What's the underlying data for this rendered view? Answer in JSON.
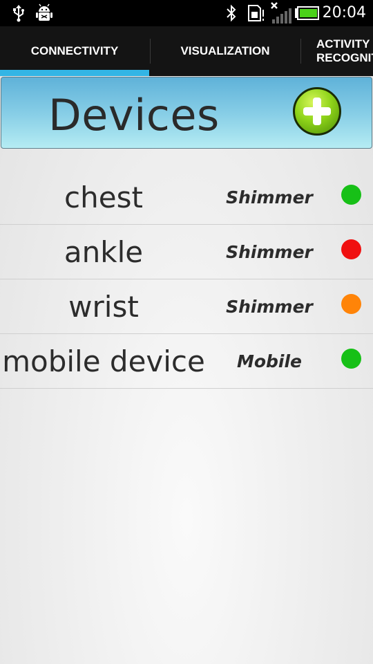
{
  "status_bar": {
    "time": "20:04",
    "icons": [
      "usb-icon",
      "android-debug-icon",
      "bluetooth-icon",
      "sd-card-icon",
      "no-signal-icon",
      "battery-icon"
    ]
  },
  "tabs": [
    {
      "label": "CONNECTIVITY",
      "selected": true
    },
    {
      "label": "VISUALIZATION",
      "selected": false
    },
    {
      "label": "ACTIVITY RECOGNIT",
      "selected": false
    }
  ],
  "header": {
    "title": "Devices",
    "add_icon": "add-circle-icon"
  },
  "devices": [
    {
      "name": "chest",
      "type": "Shimmer",
      "status_color": "#17c017"
    },
    {
      "name": "ankle",
      "type": "Shimmer",
      "status_color": "#f01010"
    },
    {
      "name": "wrist",
      "type": "Shimmer",
      "status_color": "#ff8408"
    },
    {
      "name": "mobile device",
      "type": "Mobile",
      "status_color": "#17c017"
    }
  ],
  "colors": {
    "tab_indicator": "#33b5e5",
    "tab_bar": "#141414",
    "status_bar": "#000000"
  }
}
